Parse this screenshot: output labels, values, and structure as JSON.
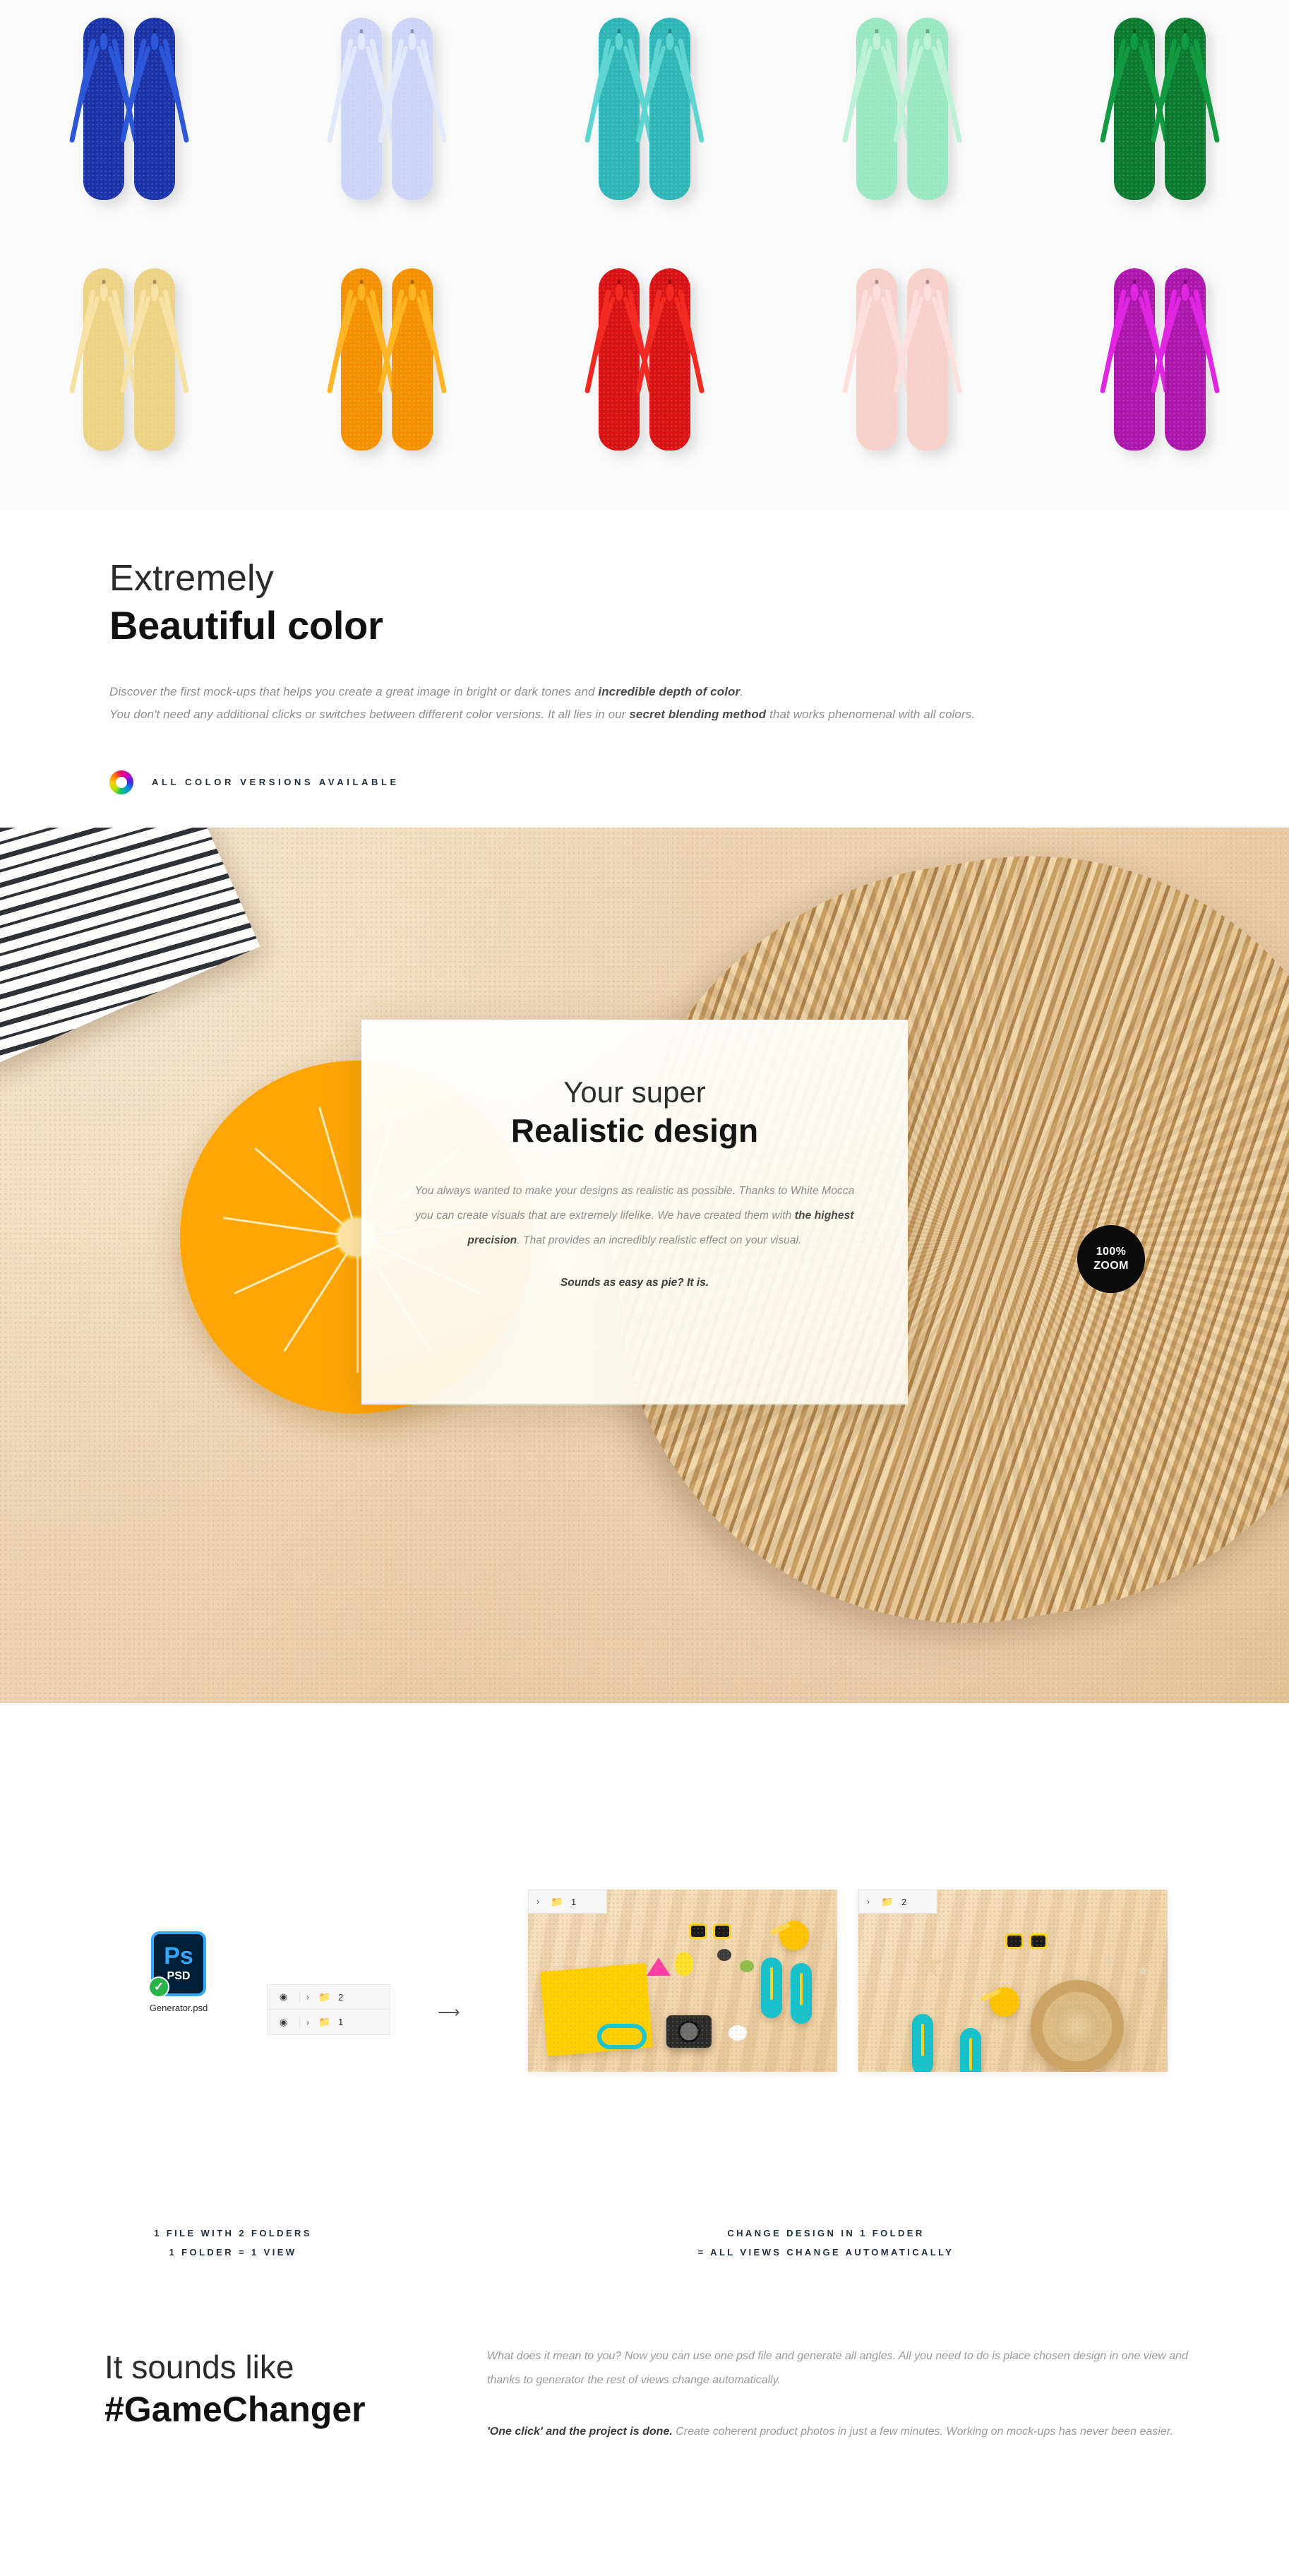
{
  "color_grid": {
    "row1": [
      {
        "name": "royal-blue",
        "sole": "#1a33a8",
        "strap": "#2b57d8"
      },
      {
        "name": "periwinkle",
        "sole": "#ccd4f7",
        "strap": "#e2e9fd"
      },
      {
        "name": "teal",
        "sole": "#2fb5b7",
        "strap": "#5fd5d2"
      },
      {
        "name": "mint",
        "sole": "#99e8c2",
        "strap": "#bdf2d8"
      },
      {
        "name": "green",
        "sole": "#0a7a2f",
        "strap": "#119a3f"
      }
    ],
    "row2": [
      {
        "name": "sand-yellow",
        "sole": "#ecd285",
        "strap": "#f5e2a4"
      },
      {
        "name": "orange",
        "sole": "#f59100",
        "strap": "#ffb524"
      },
      {
        "name": "red",
        "sole": "#d71313",
        "strap": "#f22a21"
      },
      {
        "name": "blush-pink",
        "sole": "#f8cfc9",
        "strap": "#fde0dc"
      },
      {
        "name": "magenta",
        "sole": "#ad16ad",
        "strap": "#e026e0"
      }
    ]
  },
  "beautiful": {
    "heading_thin": "Extremely",
    "heading_bold": "Beautiful color",
    "line1_pre": "Discover the first mock-ups that helps you create a great image in bright or dark tones and ",
    "line1_bold": "incredible depth of color",
    "line1_post": ".",
    "line2_pre": "You don't need any additional clicks or switches between different color versions. It all lies in our ",
    "line2_bold": "secret blending method",
    "line2_post": " that works phenomenal with all colors.",
    "badge_label": "ALL COLOR VERSIONS AVAILABLE",
    "badge_icon": "color-wheel-icon"
  },
  "photo": {
    "card_heading_thin": "Your super",
    "card_heading_bold": "Realistic design",
    "card_body_pre": "You always wanted to make your designs as realistic as possible.  Thanks to White Mocca you can create visuals that are extremely lifelike. We have created them with ",
    "card_body_bold": "the highest precision",
    "card_body_post": ". That provides an incredibly realistic effect on your visual.",
    "card_kicker": "Sounds as easy as pie? It is.",
    "zoom_badge_line1": "100%",
    "zoom_badge_line2": "ZOOM"
  },
  "generator": {
    "psd_icon_ps": "Ps",
    "psd_icon_label": "PSD",
    "psd_filename": "Generator.psd",
    "psd_check": "✓",
    "layers": [
      {
        "eye": "◉",
        "chevron": "›",
        "folder": "📁",
        "label": "2"
      },
      {
        "eye": "◉",
        "chevron": "›",
        "folder": "📁",
        "label": "1"
      }
    ],
    "arrow": "⟶",
    "thumbnails": [
      {
        "badge_chevron": "›",
        "badge_folder": "📁",
        "badge_label": "1"
      },
      {
        "badge_chevron": "›",
        "badge_folder": "📁",
        "badge_label": "2"
      }
    ],
    "caption_left_line1": "1 FILE WITH 2 FOLDERS",
    "caption_left_line2": "1 FOLDER = 1 VIEW",
    "caption_right_line1": "CHANGE DESIGN IN 1 FOLDER",
    "caption_right_line2": "= ALL VIEWS CHANGE AUTOMATICALLY"
  },
  "gamechanger": {
    "heading_thin": "It sounds like",
    "heading_bold": "#GameChanger",
    "para1": "What does it mean to you? Now you can use one psd file and generate all angles.  All you need to do is place chosen design in one view and thanks to generator the rest of views change automatically.",
    "para2_bold": "'One click' and the project is done.",
    "para2_rest": "  Create coherent product photos in just a few minutes. Working on mock-ups has never been easier."
  },
  "colors": {
    "badge_text": "#21303f",
    "accent_blue": "#31a8ff",
    "psd_dark": "#001e36",
    "check_green": "#2bb34b",
    "zoom_badge_bg": "#0b0b0b"
  }
}
